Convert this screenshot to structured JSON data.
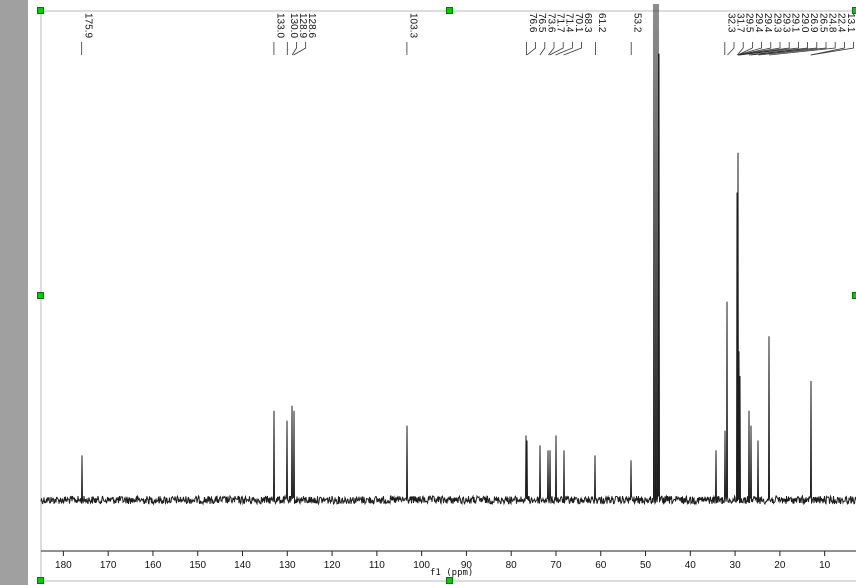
{
  "colors": {
    "spectrum_line": "#1e1e1e",
    "axis": "#222222",
    "selection_frame": "#b8b8b8",
    "handle_fill": "#00cc00",
    "side_panel": "#a0a0a0"
  },
  "chart_data": {
    "type": "line",
    "title": "",
    "xlabel": "f1 (ppm)",
    "ylabel": "",
    "xlim": [
      185,
      3
    ],
    "x_reversed": true,
    "ticks": [
      180,
      170,
      160,
      150,
      140,
      130,
      120,
      110,
      100,
      90,
      80,
      70,
      60,
      50,
      40,
      30,
      20,
      10
    ],
    "grid": false,
    "legend": "none",
    "baseline_noise_level": 0.05,
    "peaks": [
      {
        "ppm": 175.9,
        "height": 0.09
      },
      {
        "ppm": 133.0,
        "height": 0.18
      },
      {
        "ppm": 130.0,
        "height": 0.16
      },
      {
        "ppm": 128.9,
        "height": 0.19
      },
      {
        "ppm": 128.6,
        "height": 0.18
      },
      {
        "ppm": 103.3,
        "height": 0.15
      },
      {
        "ppm": 76.6,
        "height": 0.13
      },
      {
        "ppm": 76.5,
        "height": 0.12
      },
      {
        "ppm": 73.6,
        "height": 0.11
      },
      {
        "ppm": 71.7,
        "height": 0.1
      },
      {
        "ppm": 71.4,
        "height": 0.1
      },
      {
        "ppm": 70.1,
        "height": 0.13
      },
      {
        "ppm": 68.3,
        "height": 0.1
      },
      {
        "ppm": 61.2,
        "height": 0.09
      },
      {
        "ppm": 53.2,
        "height": 0.08
      },
      {
        "ppm": 48.1,
        "height": 1.0
      },
      {
        "ppm": 47.6,
        "height": 1.0
      },
      {
        "ppm": 47.2,
        "height": 1.0
      },
      {
        "ppm": 46.9,
        "height": 0.9
      },
      {
        "ppm": 34.2,
        "height": 0.1
      },
      {
        "ppm": 32.3,
        "height": 0.14
      },
      {
        "ppm": 31.7,
        "height": 0.4
      },
      {
        "ppm": 29.5,
        "height": 0.62
      },
      {
        "ppm": 29.4,
        "height": 0.7
      },
      {
        "ppm": 29.3,
        "height": 0.33
      },
      {
        "ppm": 29.1,
        "height": 0.3
      },
      {
        "ppm": 29.0,
        "height": 0.25
      },
      {
        "ppm": 26.9,
        "height": 0.18
      },
      {
        "ppm": 26.5,
        "height": 0.15
      },
      {
        "ppm": 24.8,
        "height": 0.12
      },
      {
        "ppm": 22.4,
        "height": 0.33
      },
      {
        "ppm": 13.1,
        "height": 0.24
      }
    ],
    "peak_labels": [
      {
        "ppm": 175.9,
        "label": "175.9"
      },
      {
        "ppm": 133.0,
        "label": "133.0"
      },
      {
        "ppm": 130.0,
        "label": "130.0"
      },
      {
        "ppm": 128.9,
        "label": "128.9"
      },
      {
        "ppm": 128.6,
        "label": "128.6"
      },
      {
        "ppm": 103.3,
        "label": "103.3"
      },
      {
        "ppm": 76.6,
        "label": "76.6"
      },
      {
        "ppm": 76.5,
        "label": "76.5"
      },
      {
        "ppm": 73.6,
        "label": "73.6"
      },
      {
        "ppm": 71.7,
        "label": "71.7"
      },
      {
        "ppm": 71.4,
        "label": "71.4"
      },
      {
        "ppm": 70.1,
        "label": "70.1"
      },
      {
        "ppm": 68.3,
        "label": "68.3"
      },
      {
        "ppm": 61.2,
        "label": "61.2"
      },
      {
        "ppm": 53.2,
        "label": "53.2"
      },
      {
        "ppm": 32.3,
        "label": "32.3"
      },
      {
        "ppm": 31.7,
        "label": "31.7"
      },
      {
        "ppm": 29.5,
        "label": "29.5"
      },
      {
        "ppm": 29.4,
        "label": "29.4"
      },
      {
        "ppm": 29.4,
        "label": "29.4"
      },
      {
        "ppm": 29.3,
        "label": "29.3"
      },
      {
        "ppm": 29.3,
        "label": "29.3"
      },
      {
        "ppm": 29.1,
        "label": "29.1"
      },
      {
        "ppm": 29.0,
        "label": "29.0"
      },
      {
        "ppm": 26.9,
        "label": "26.9"
      },
      {
        "ppm": 26.5,
        "label": "26.5"
      },
      {
        "ppm": 24.8,
        "label": "24.8"
      },
      {
        "ppm": 22.4,
        "label": "22.4"
      },
      {
        "ppm": 13.1,
        "label": "13.1"
      },
      {
        "ppm": 13.1,
        "label": "13.1"
      }
    ]
  }
}
